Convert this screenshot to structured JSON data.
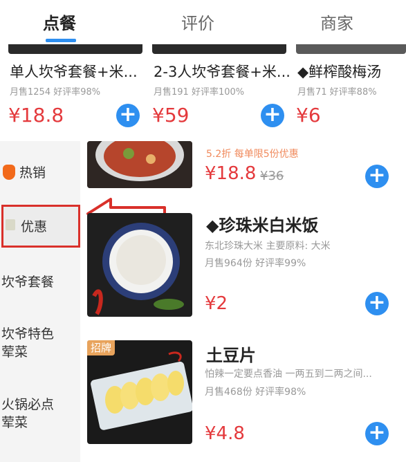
{
  "tabs": [
    {
      "label": "点餐",
      "active": true
    },
    {
      "label": "评价",
      "active": false
    },
    {
      "label": "商家",
      "active": false
    }
  ],
  "recommended": [
    {
      "name": "单人坎爷套餐+米...",
      "meta": "月售1254 好评率98%",
      "price": "¥18.8"
    },
    {
      "name": "2-3人坎爷套餐+米...",
      "meta": "月售191 好评率100%",
      "price": "¥59"
    },
    {
      "name": "◆鲜榨酸梅汤",
      "meta": "月售71 好评率88%",
      "price": "¥6"
    }
  ],
  "sidebar": {
    "items": [
      {
        "label": "热销",
        "icon": "flame-icon"
      },
      {
        "label": "优惠",
        "icon": "coupon-icon"
      },
      {
        "label": "坎爷套餐"
      },
      {
        "label": "坎爷特色荤菜"
      },
      {
        "label": "火锅必点荤菜"
      }
    ]
  },
  "dishes": [
    {
      "promo": "5.2折 每单限5份优惠",
      "price": "¥18.8",
      "original_price": "¥36"
    },
    {
      "title": "◆珍珠米白米饭",
      "desc": "东北珍珠大米 主要原料: 大米",
      "sales": "月售964份 好评率99%",
      "price": "¥2"
    },
    {
      "badge": "招牌",
      "title": "土豆片",
      "desc": "怕辣一定要点香油 一两五到二两之间...",
      "sales": "月售468份 好评率98%",
      "price": "¥4.8"
    }
  ],
  "colors": {
    "accent": "#2e8ff0",
    "price": "#e4393c",
    "annotation": "#d9302a"
  }
}
